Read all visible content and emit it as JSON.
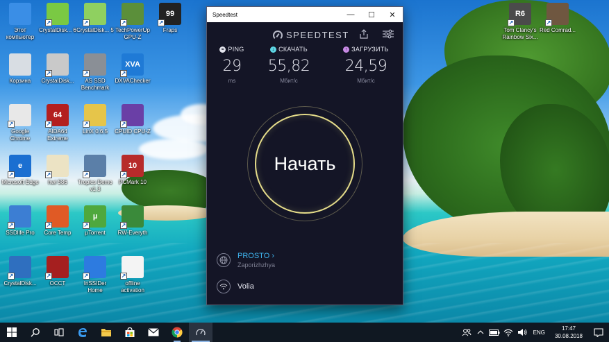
{
  "desktop": {
    "icons": [
      {
        "label": "Этот компьютер",
        "glyph": "",
        "bg": "#3a8ee6"
      },
      {
        "label": "CrystalDisk... 6",
        "glyph": "",
        "bg": "#7ac943"
      },
      {
        "label": "CrystalDisk... 5",
        "glyph": "",
        "bg": "#8fd060"
      },
      {
        "label": "TechPowerUp GPU-Z",
        "glyph": "",
        "bg": "#5b8f3a"
      },
      {
        "label": "Fraps",
        "glyph": "99",
        "bg": "#222222"
      },
      {
        "label": "Корзина",
        "glyph": "",
        "bg": "#d8dde3"
      },
      {
        "label": "CrystalDisk...",
        "glyph": "",
        "bg": "#c9c9c9"
      },
      {
        "label": "AS SSD Benchmark",
        "glyph": "",
        "bg": "#8a8f96"
      },
      {
        "label": "DXVAChecker",
        "glyph": "XVA",
        "bg": "#1f7ad6"
      },
      {
        "label": "Google Chrome",
        "glyph": "",
        "bg": "#e8e8e8"
      },
      {
        "label": "AIDA64 Extreme",
        "glyph": "64",
        "bg": "#b31f1f"
      },
      {
        "label": "LinX 0.6.5",
        "glyph": "",
        "bg": "#e6c54a"
      },
      {
        "label": "CPUID CPU-Z",
        "glyph": "",
        "bg": "#6a3fa6"
      },
      {
        "label": "Microsoft Edge",
        "glyph": "e",
        "bg": "#1b6fd1"
      },
      {
        "label": "hwi 586",
        "glyph": "",
        "bg": "#ece3c4"
      },
      {
        "label": "Tropics Demo v1.3",
        "glyph": "",
        "bg": "#5b7fa8"
      },
      {
        "label": "PCMark 10",
        "glyph": "10",
        "bg": "#b72b2b"
      },
      {
        "label": "SSDlife Pro",
        "glyph": "",
        "bg": "#3c7ed3"
      },
      {
        "label": "Core Temp",
        "glyph": "",
        "bg": "#e05a25"
      },
      {
        "label": "µTorrent",
        "glyph": "µ",
        "bg": "#4fa83d"
      },
      {
        "label": "RW-Everyth",
        "glyph": "",
        "bg": "#3a8a3a"
      },
      {
        "label": "CrystalDisk...",
        "glyph": "",
        "bg": "#2f6fbf"
      },
      {
        "label": "OCCT",
        "glyph": "",
        "bg": "#a51f1f"
      },
      {
        "label": "InSSIDer Home",
        "glyph": "",
        "bg": "#2d7be0"
      },
      {
        "label": "offline activation",
        "glyph": "",
        "bg": "#f4f4f4"
      },
      {
        "label": "Tom Clancy's Rainbow Six...",
        "glyph": "R6",
        "bg": "#4b4b4b"
      },
      {
        "label": "Red Comrad...",
        "glyph": "",
        "bg": "#6f5740"
      }
    ]
  },
  "window": {
    "title": "Speedtest",
    "minimize": "—",
    "maximize": "☐",
    "close": "✕"
  },
  "speedtest": {
    "logo": "SPEEDTEST",
    "ping": {
      "label": "PING",
      "value": "29",
      "unit": "ms",
      "color": "#e4e5ee"
    },
    "download": {
      "label": "СКАЧАТЬ",
      "value": "55,82",
      "unit": "Мбит/с",
      "color": "#5dd6e4"
    },
    "upload": {
      "label": "ЗАГРУЗИТЬ",
      "value": "24,59",
      "unit": "Мбит/с",
      "color": "#c98be6"
    },
    "go_label": "Начать",
    "server_name": "PROSTO",
    "server_location": "Zaporizhzhya",
    "provider": "Volia"
  },
  "taskbar": {
    "lang": "ENG",
    "time": "17:47",
    "date": "30.08.2018"
  }
}
